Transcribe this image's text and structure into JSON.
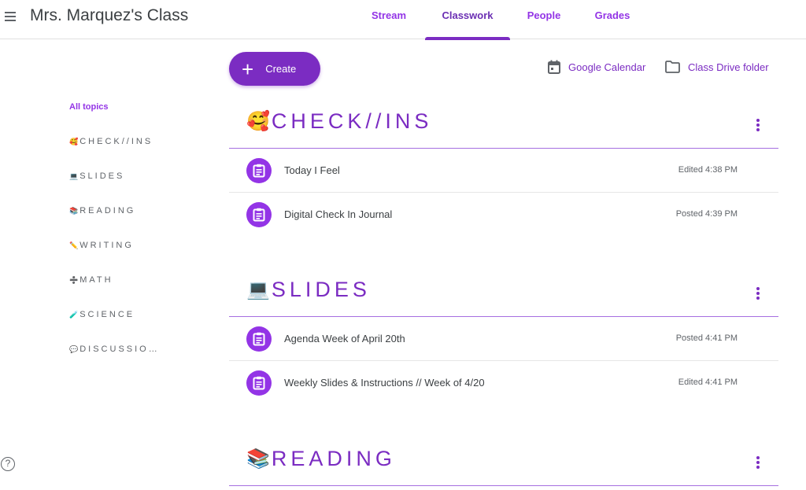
{
  "header": {
    "class_name": "Mrs. Marquez's Class",
    "tabs": [
      {
        "label": "Stream",
        "active": false
      },
      {
        "label": "Classwork",
        "active": true
      },
      {
        "label": "People",
        "active": false
      },
      {
        "label": "Grades",
        "active": false
      }
    ]
  },
  "toolbar": {
    "create_label": "Create",
    "calendar_label": "Google Calendar",
    "drive_label": "Class Drive folder"
  },
  "colors": {
    "accent": "#7b2cc2",
    "accent_light": "#9334e6",
    "divider": "#a56fe0"
  },
  "sidebar": {
    "all_topics": "All topics",
    "topics": [
      {
        "emoji": "🥰",
        "label": "CHECK//INS"
      },
      {
        "emoji": "💻",
        "label": "SLIDES"
      },
      {
        "emoji": "📚",
        "label": "READING"
      },
      {
        "emoji": "✏️",
        "label": "WRITING"
      },
      {
        "emoji": "➗",
        "label": "MATH"
      },
      {
        "emoji": "🧪",
        "label": "SCIENCE"
      },
      {
        "emoji": "💬",
        "label": "DISCUSSIO…"
      }
    ]
  },
  "sections": [
    {
      "emoji": "🥰",
      "title": "CHECK//INS",
      "items": [
        {
          "title": "Today I Feel",
          "meta": "Edited 4:38 PM"
        },
        {
          "title": "Digital Check In Journal",
          "meta": "Posted 4:39 PM"
        }
      ]
    },
    {
      "emoji": "💻",
      "title": "SLIDES",
      "items": [
        {
          "title": "Agenda Week of April 20th",
          "meta": "Posted 4:41 PM"
        },
        {
          "title": "Weekly Slides & Instructions // Week of 4/20",
          "meta": "Edited 4:41 PM"
        }
      ]
    },
    {
      "emoji": "📚",
      "title": "READING",
      "items": []
    }
  ],
  "help_label": "?"
}
